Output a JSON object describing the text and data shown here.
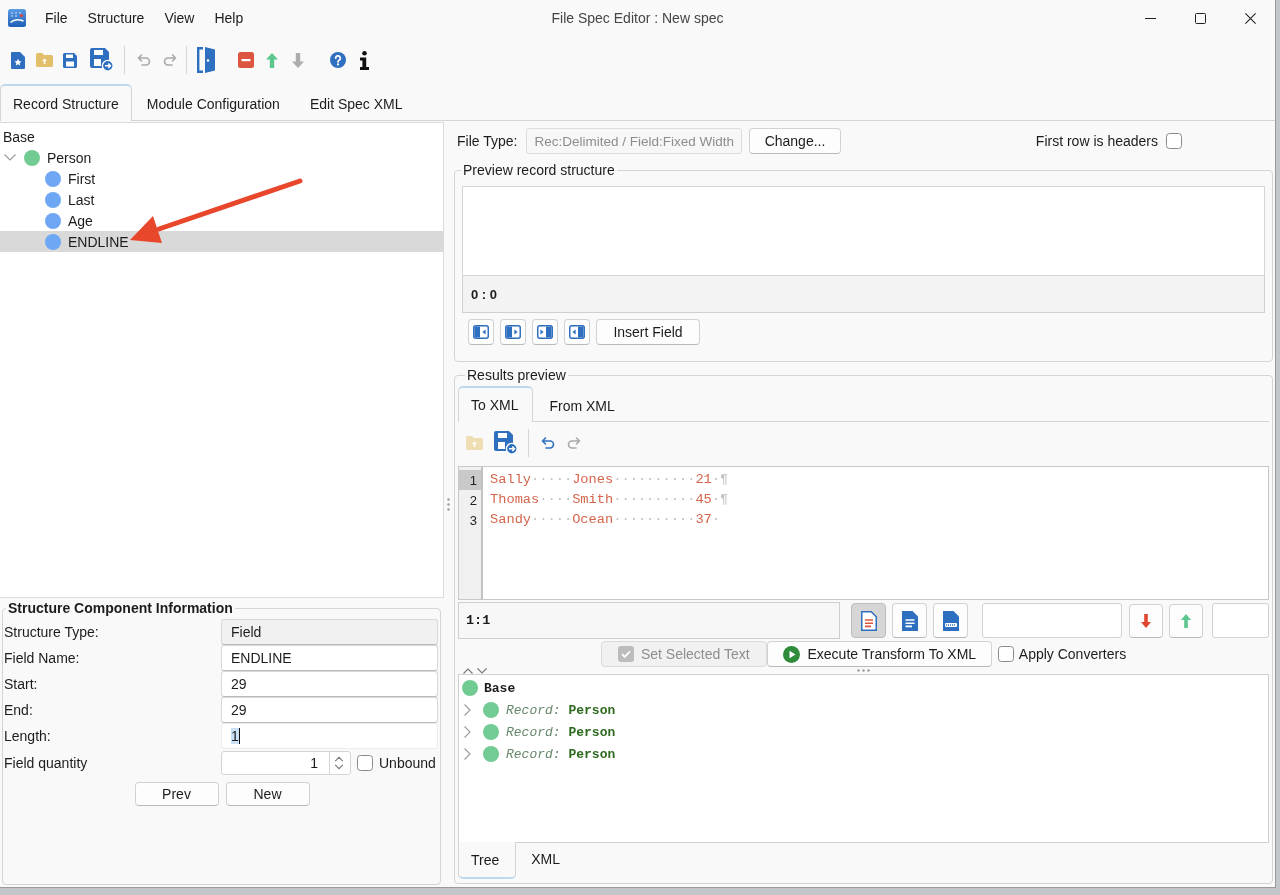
{
  "window": {
    "title": "File Spec Editor : New spec"
  },
  "menu": [
    "File",
    "Structure",
    "View",
    "Help"
  ],
  "toolbar": [
    {
      "divider": true,
      "items": [
        {
          "kind": "new",
          "disabled": false
        },
        {
          "kind": "open",
          "disabled": false
        },
        {
          "kind": "save",
          "disabled": false
        },
        {
          "kind": "save-as",
          "disabled": false
        }
      ]
    },
    {
      "divider": true,
      "items": [
        {
          "kind": "undo",
          "disabled": true
        },
        {
          "kind": "redo",
          "disabled": true
        }
      ]
    },
    {
      "divider": false,
      "items": [
        {
          "kind": "exit",
          "disabled": false
        }
      ]
    },
    {
      "divider": false,
      "items": [
        {
          "kind": "delete",
          "disabled": false
        },
        {
          "kind": "move-up",
          "disabled": false
        },
        {
          "kind": "move-down",
          "disabled": true
        }
      ]
    },
    {
      "divider": false,
      "items": [
        {
          "kind": "help",
          "disabled": false
        },
        {
          "kind": "info",
          "disabled": false
        }
      ]
    }
  ],
  "tabs": [
    {
      "label": "Record Structure",
      "selected": true
    },
    {
      "label": "Module Configuration",
      "selected": false
    },
    {
      "label": "Edit Spec XML",
      "selected": false
    }
  ],
  "structure_tree": {
    "root": "Base",
    "items": [
      {
        "label": "Person",
        "color": "#72cb93",
        "expanded": true,
        "selected": false,
        "children": [
          {
            "label": "First",
            "color": "#6ea8f5",
            "selected": false
          },
          {
            "label": "Last",
            "color": "#6ea8f5",
            "selected": false
          },
          {
            "label": "Age",
            "color": "#6ea8f5",
            "selected": false
          },
          {
            "label": "ENDLINE",
            "color": "#6ea8f5",
            "selected": true
          }
        ]
      }
    ]
  },
  "component_info": {
    "title": "Structure Component Information",
    "fields": [
      {
        "label": "Structure Type:",
        "value": "Field",
        "readonly": true,
        "focused": false
      },
      {
        "label": "Field Name:",
        "value": "ENDLINE",
        "readonly": false,
        "focused": false
      },
      {
        "label": "Start:",
        "value": "29",
        "readonly": false,
        "focused": false
      },
      {
        "label": "End:",
        "value": "29",
        "readonly": false,
        "focused": false
      },
      {
        "label": "Length:",
        "value": "1",
        "readonly": false,
        "focused": true
      }
    ],
    "quantity": {
      "label": "Field quantity",
      "value": "1"
    },
    "unbound": {
      "label": "Unbound",
      "checked": false
    },
    "buttons": [
      "Prev",
      "New"
    ]
  },
  "file_type": {
    "label": "File Type:",
    "value": "Rec:Delimited / Field:Fixed Width",
    "disabled": true,
    "button": "Change..."
  },
  "first_row_headers": {
    "label": "First row is headers",
    "checked": false
  },
  "preview": {
    "title": "Preview record structure",
    "position": "0 : 0",
    "button": "Insert Field"
  },
  "results": {
    "title": "Results preview",
    "tabs": [
      {
        "label": "To XML",
        "selected": true
      },
      {
        "label": "From XML",
        "selected": false
      }
    ],
    "toolbar": [
      {
        "divider": true,
        "items": [
          {
            "kind": "open",
            "disabled": true
          },
          {
            "kind": "save-as",
            "disabled": false
          }
        ]
      },
      {
        "divider": false,
        "items": [
          {
            "kind": "undo",
            "disabled": false
          },
          {
            "kind": "redo",
            "disabled": true
          }
        ]
      }
    ],
    "editor": {
      "lines": [
        {
          "number": "1",
          "current": true,
          "segments": [
            {
              "kind": "text",
              "text": "Sally"
            },
            {
              "kind": "whitespace",
              "text": "·····"
            },
            {
              "kind": "text",
              "text": "Jones"
            },
            {
              "kind": "whitespace",
              "text": "··········"
            },
            {
              "kind": "text",
              "text": "21"
            },
            {
              "kind": "whitespace",
              "text": "·¶"
            }
          ]
        },
        {
          "number": "2",
          "current": false,
          "segments": [
            {
              "kind": "text",
              "text": "Thomas"
            },
            {
              "kind": "whitespace",
              "text": "····"
            },
            {
              "kind": "text",
              "text": "Smith"
            },
            {
              "kind": "whitespace",
              "text": "··········"
            },
            {
              "kind": "text",
              "text": "45"
            },
            {
              "kind": "whitespace",
              "text": "·¶"
            }
          ]
        },
        {
          "number": "3",
          "current": false,
          "segments": [
            {
              "kind": "text",
              "text": "Sandy"
            },
            {
              "kind": "whitespace",
              "text": "·····"
            },
            {
              "kind": "text",
              "text": "Ocean"
            },
            {
              "kind": "whitespace",
              "text": "··········"
            },
            {
              "kind": "text",
              "text": "37"
            },
            {
              "kind": "whitespace",
              "text": "·"
            }
          ]
        }
      ]
    },
    "cursor": "1:1",
    "view_buttons": [
      {
        "kind": "text",
        "selected": true
      },
      {
        "kind": "document",
        "selected": false
      },
      {
        "kind": "html",
        "selected": false
      }
    ],
    "set_selected": {
      "label": "Set Selected Text",
      "disabled": true
    },
    "execute": {
      "label": "Execute Transform To XML"
    },
    "apply_converters": {
      "label": "Apply Converters",
      "checked": false
    },
    "tree": {
      "root": "Base",
      "items": [
        {
          "label": "Record:",
          "name": "Person",
          "expanded": false
        },
        {
          "label": "Record:",
          "name": "Person",
          "expanded": false
        },
        {
          "label": "Record:",
          "name": "Person",
          "expanded": false
        }
      ]
    },
    "bottom_tabs": [
      {
        "label": "Tree",
        "selected": true
      },
      {
        "label": "XML",
        "selected": false
      }
    ]
  }
}
